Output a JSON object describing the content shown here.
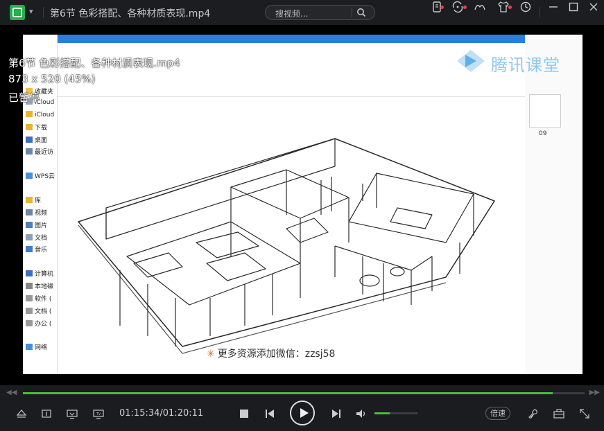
{
  "titlebar": {
    "title": "第6节 色彩搭配、各种材质表现.mp4",
    "search_placeholder": "搜视频..."
  },
  "overlay": {
    "filename": "第6节 色彩搭配、各种材质表现.mp4",
    "resolution": "873 x 520 (45%)",
    "status": "已暂停"
  },
  "video": {
    "explorer_items": [
      "收藏夹",
      "iCloud",
      "iCloud",
      "下载",
      "桌面",
      "最近访",
      "WPS云",
      "库",
      "视频",
      "图片",
      "文档",
      "音乐",
      "计算机",
      "本地磁",
      "软件 (",
      "文档 (",
      "办公 (",
      "网络"
    ],
    "watermark_text": "腾讯课堂",
    "promo_text": "更多资源添加微信：zzsj58",
    "right_pane_label": "09"
  },
  "controls": {
    "time": "01:15:34/01:20:11",
    "progress": 0.943,
    "volume": 0.35,
    "speed_label": "倍速"
  },
  "colors": {
    "accent": "#4dbb3d",
    "titlebar_bg": "#1c1d20",
    "control_bg": "#1b1c1f",
    "watermark": "#8fc8ef"
  }
}
